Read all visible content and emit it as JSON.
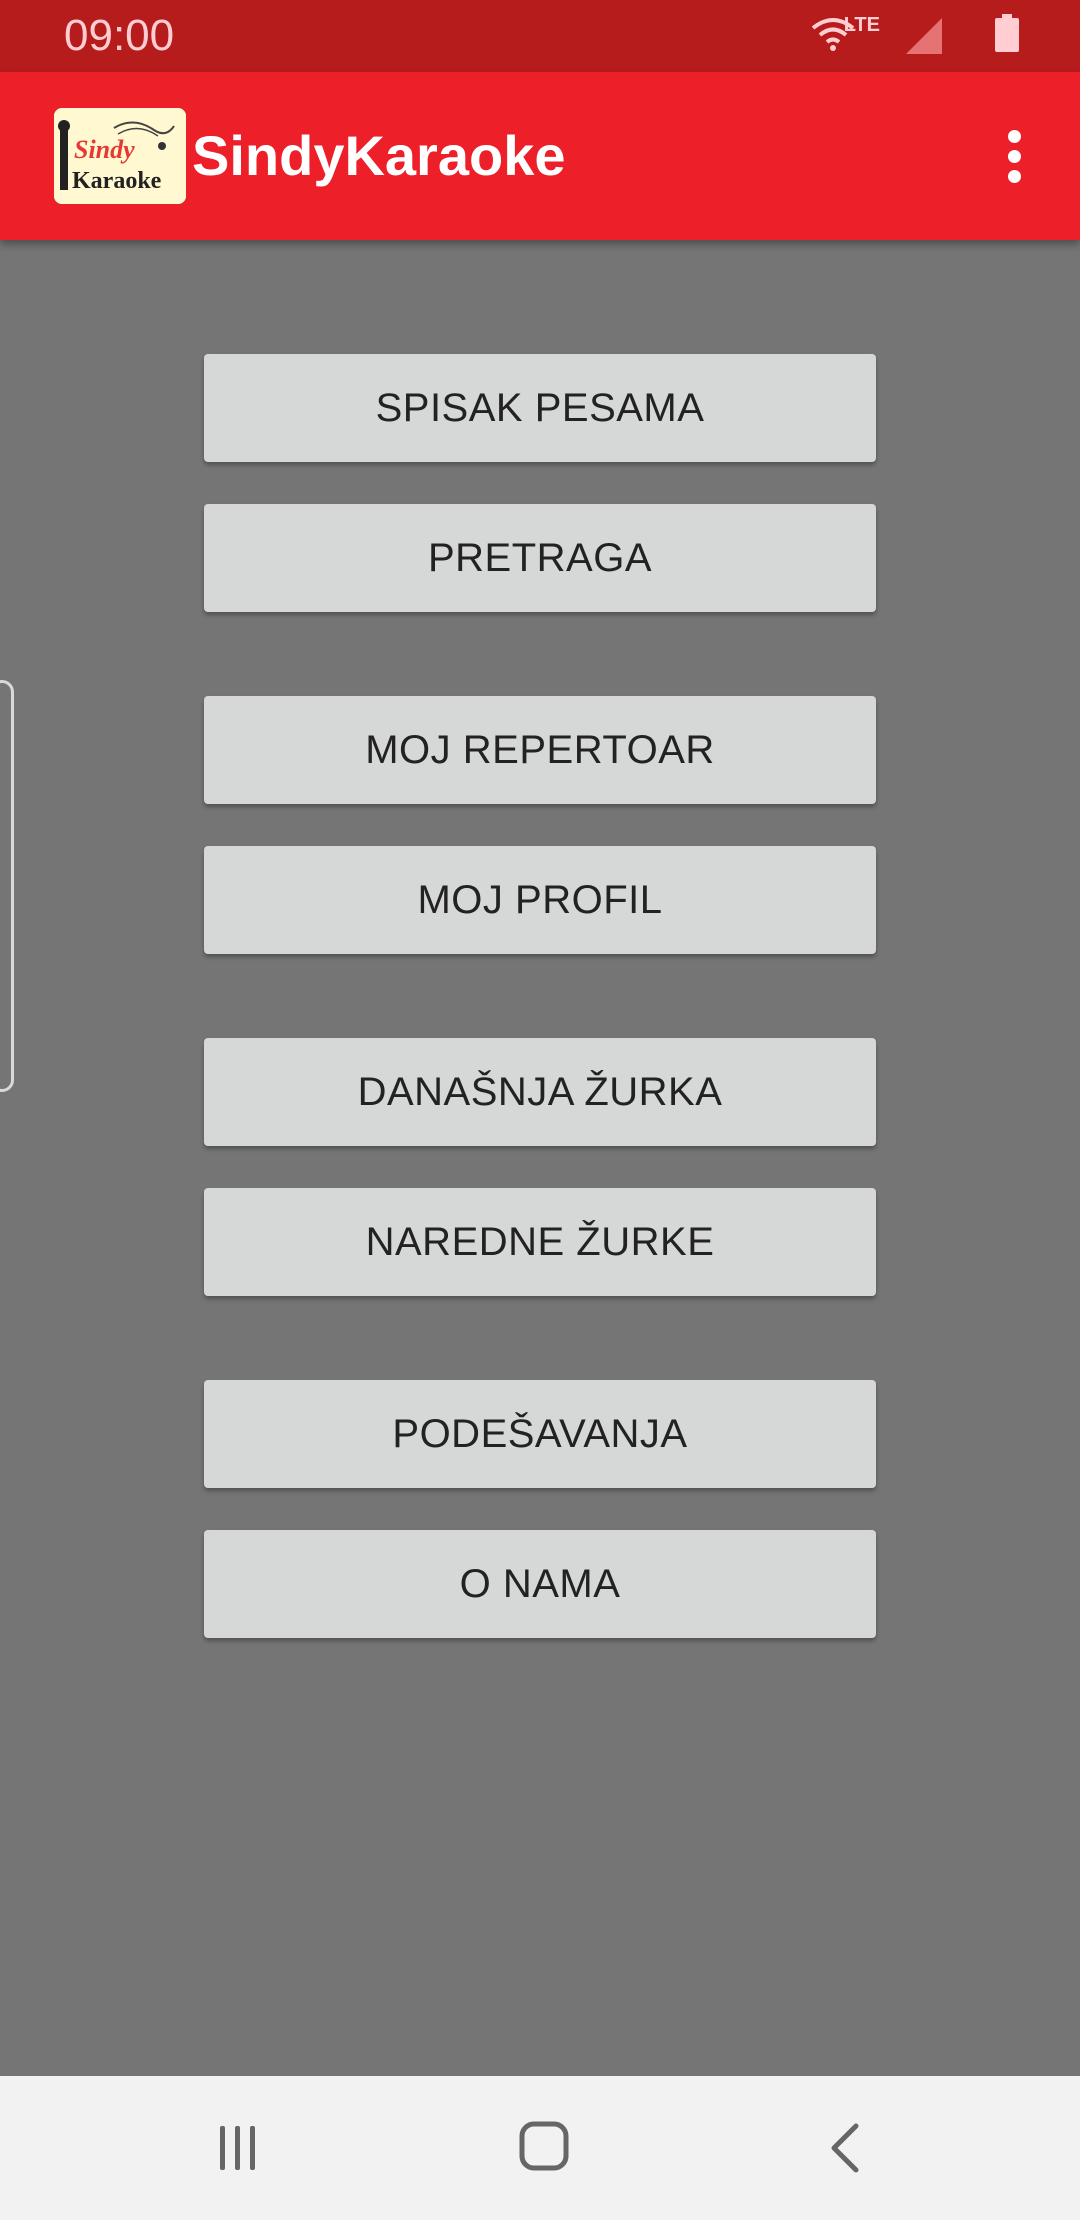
{
  "status_bar": {
    "time": "09:00",
    "network_label": "LTE",
    "icons": [
      "wifi-icon",
      "lte-icon",
      "signal-icon",
      "battery-icon"
    ]
  },
  "app_bar": {
    "logo_icon": "sindy-karaoke-logo",
    "title": "SindyKaraoke",
    "menu_icon": "overflow-menu-icon",
    "background": "#ed1f28"
  },
  "menu": {
    "buttons": [
      {
        "label": "SPISAK PESAMA"
      },
      {
        "label": "PRETRAGA"
      },
      {
        "label": "MOJ REPERTOAR"
      },
      {
        "label": "MOJ PROFIL"
      },
      {
        "label": "DANAŠNJA ŽURKA"
      },
      {
        "label": "NAREDNE ŽURKE"
      },
      {
        "label": "PODEŠAVANJA"
      },
      {
        "label": "O NAMA"
      }
    ]
  },
  "nav_bar": {
    "icons": [
      "recent-apps-icon",
      "home-icon",
      "back-icon"
    ]
  },
  "colors": {
    "status_bar": "#b71c1c",
    "app_bar": "#ed1f28",
    "background": "#757575",
    "button": "#d6d7d7"
  }
}
